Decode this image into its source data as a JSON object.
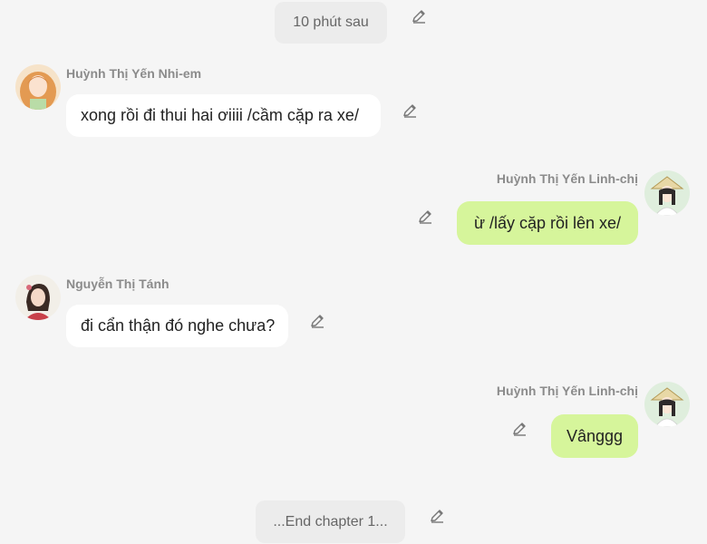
{
  "colors": {
    "background": "#f5f5f5",
    "system_pill": "#ececec",
    "incoming_bubble": "#ffffff",
    "outgoing_bubble": "#d6f59b",
    "name_text": "#8b8b8b"
  },
  "system_top": {
    "text": "10 phút sau",
    "icon": "pencil-icon"
  },
  "messages": [
    {
      "direction": "incoming",
      "sender": "Huỳnh Thị Yến Nhi-em",
      "text": "xong rồi đi thui hai ơiiii /cầm cặp ra xe/",
      "avatar": "avatar-girl-orange-hair",
      "edit_icon": "pencil-icon"
    },
    {
      "direction": "outgoing",
      "sender": "Huỳnh Thị Yến Linh-chị",
      "text": "ừ /lấy cặp rồi lên xe/",
      "avatar": "avatar-girl-conical-hat",
      "edit_icon": "pencil-icon"
    },
    {
      "direction": "incoming",
      "sender": "Nguyễn Thị Tánh",
      "text": "đi cẩn thận đó nghe chưa?",
      "avatar": "avatar-woman-red",
      "edit_icon": "pencil-icon"
    },
    {
      "direction": "outgoing",
      "sender": "Huỳnh Thị Yến Linh-chị",
      "text": "Vânggg",
      "avatar": "avatar-girl-conical-hat",
      "edit_icon": "pencil-icon"
    }
  ],
  "system_bottom": {
    "text": "...End chapter 1...",
    "icon": "pencil-icon"
  }
}
